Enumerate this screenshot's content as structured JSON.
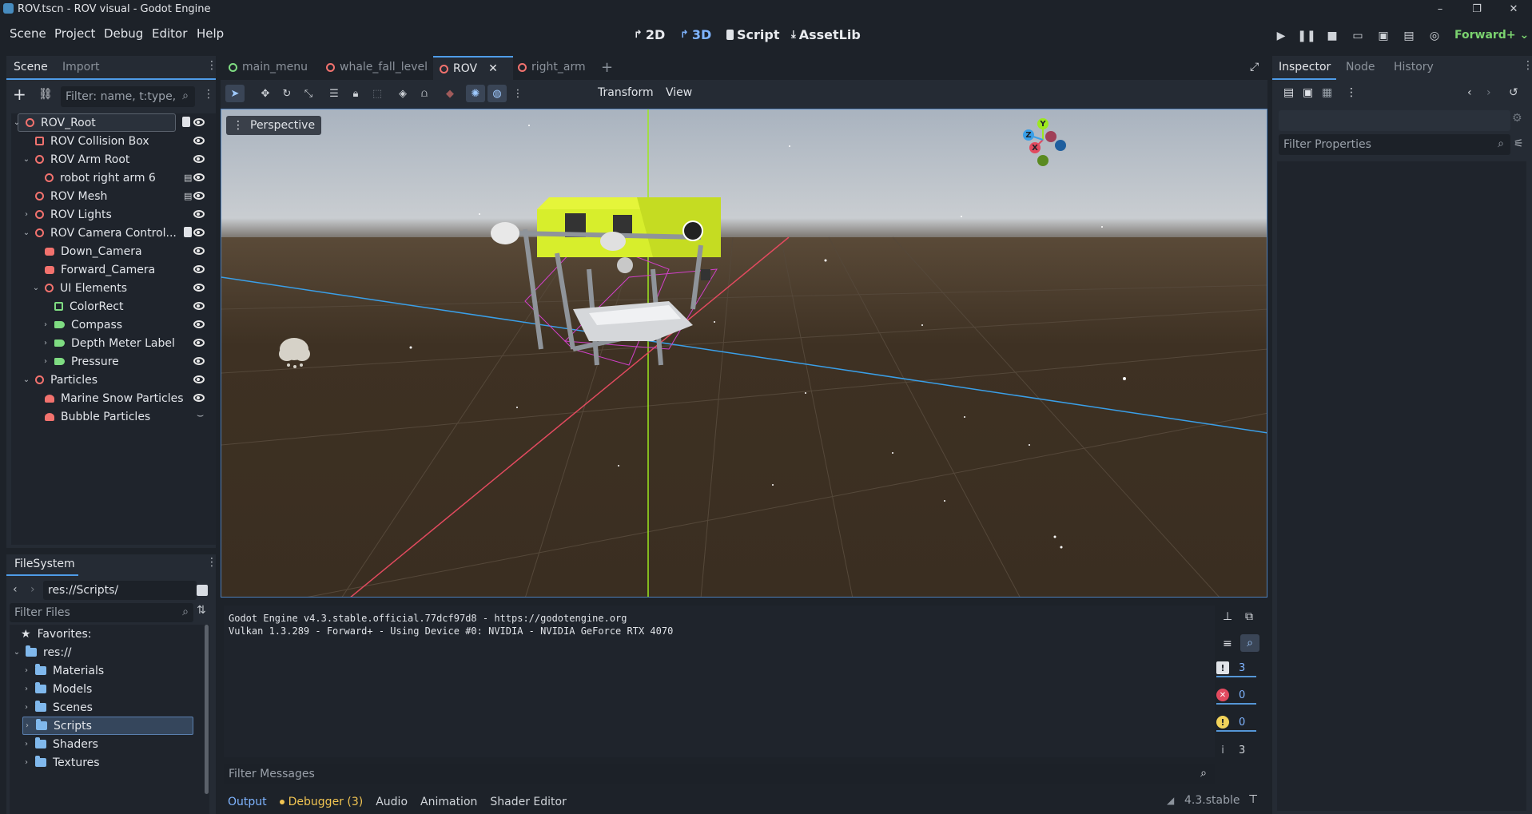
{
  "window": {
    "title": "ROV.tscn - ROV visual - Godot Engine",
    "minimize": "–",
    "maximize": "❐",
    "close": "✕"
  },
  "menu": [
    "Scene",
    "Project",
    "Debug",
    "Editor",
    "Help"
  ],
  "workspaces": {
    "w2d": "2D",
    "w3d": "3D",
    "script": "Script",
    "assetlib": "AssetLib"
  },
  "renderer": "Forward+",
  "scene_dock": {
    "tabs": [
      "Scene",
      "Import"
    ],
    "filter_placeholder": "Filter: name, t:type,",
    "nodes": [
      {
        "label": "ROV_Root",
        "icon": "node3d-root-icon"
      },
      {
        "label": "ROV Collision Box",
        "icon": "collision-icon"
      },
      {
        "label": "ROV Arm Root",
        "icon": "node3d-icon"
      },
      {
        "label": "robot right arm 6",
        "icon": "node3d-icon"
      },
      {
        "label": "ROV Mesh",
        "icon": "node3d-icon"
      },
      {
        "label": "ROV Lights",
        "icon": "node3d-icon"
      },
      {
        "label": "ROV Camera Control...",
        "icon": "node3d-icon"
      },
      {
        "label": "Down_Camera",
        "icon": "camera-icon"
      },
      {
        "label": "Forward_Camera",
        "icon": "camera-icon"
      },
      {
        "label": "UI Elements",
        "icon": "node3d-icon"
      },
      {
        "label": "ColorRect",
        "icon": "colorrect-icon"
      },
      {
        "label": "Compass",
        "icon": "label-icon"
      },
      {
        "label": "Depth Meter Label",
        "icon": "label-icon"
      },
      {
        "label": "Pressure",
        "icon": "label-icon"
      },
      {
        "label": "Particles",
        "icon": "node3d-icon"
      },
      {
        "label": "Marine Snow Particles",
        "icon": "particles-icon"
      },
      {
        "label": "Bubble Particles",
        "icon": "particles-icon"
      }
    ]
  },
  "filesystem": {
    "tab": "FileSystem",
    "path": "res://Scripts/",
    "filter_placeholder": "Filter Files",
    "favorites": "Favorites:",
    "root": "res://",
    "folders": [
      "Materials",
      "Models",
      "Scenes",
      "Scripts",
      "Shaders",
      "Textures"
    ],
    "selected": "Scripts"
  },
  "scene_tabs": [
    "main_menu",
    "whale_fall_level",
    "ROV",
    "right_arm"
  ],
  "active_scene_tab": "ROV",
  "viewport_toolbar": {
    "transform": "Transform",
    "view": "View"
  },
  "viewport": {
    "perspective_label": "Perspective",
    "gizmo": {
      "x": "X",
      "y": "Y",
      "z": "Z"
    }
  },
  "output": {
    "lines": [
      "Godot Engine v4.3.stable.official.77dcf97d8 - https://godotengine.org",
      "Vulkan 1.3.289 - Forward+ - Using Device #0: NVIDIA - NVIDIA GeForce RTX 4070"
    ],
    "filter_placeholder": "Filter Messages",
    "counts": {
      "messages": "3",
      "errors": "0",
      "warnings": "0",
      "info": "3"
    }
  },
  "bottom_tabs": [
    "Output",
    "Debugger (3)",
    "Audio",
    "Animation",
    "Shader Editor"
  ],
  "version": "4.3.stable",
  "inspector": {
    "tabs": [
      "Inspector",
      "Node",
      "History"
    ],
    "filter_placeholder": "Filter Properties"
  },
  "colors": {
    "accent": "#4f9ce8",
    "node3d": "#f2726e",
    "control": "#7fdc82",
    "folder": "#80b8ec",
    "x_axis": "#e24a5f",
    "y_axis": "#9de81e",
    "z_axis": "#3a9fe8",
    "hull": "#d7ee2c"
  }
}
